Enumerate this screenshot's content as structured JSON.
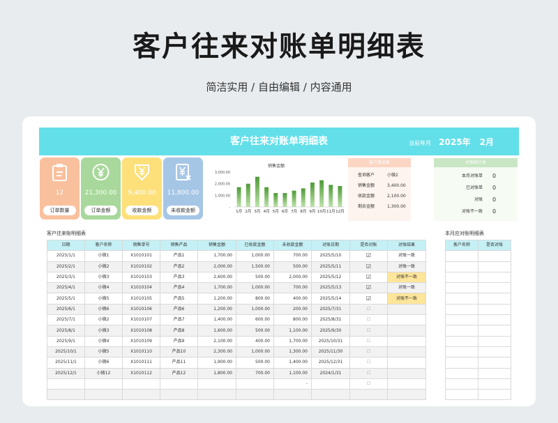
{
  "hero": {
    "title": "客户往来对账单明细表",
    "subtitle": "简洁实用 / 自由编辑 / 内容通用"
  },
  "banner": {
    "title": "客户往来对账单明细表",
    "date_label": "当前年月",
    "year": "2025年",
    "month": "2月"
  },
  "colors": {
    "banner": "#63dfe9",
    "kpi_orders": "#f9c09d",
    "kpi_amount": "#a8d89b",
    "kpi_received": "#fde07a",
    "kpi_unreceived": "#a6c6e6",
    "bar": "#6bb04e",
    "warn": "#fde59a"
  },
  "kpis": [
    {
      "icon": "clipboard-icon",
      "value": "12",
      "label": "订单数量",
      "color": "#f9c09d"
    },
    {
      "icon": "yen-coin-icon",
      "value": "21,300.00",
      "label": "订单金额",
      "color": "#a8d89b"
    },
    {
      "icon": "yen-down-icon",
      "value": "9,400.00",
      "label": "收款金额",
      "color": "#fde07a"
    },
    {
      "icon": "yen-document-icon",
      "value": "11,800.00",
      "label": "未收款金额",
      "color": "#a6c6e6"
    }
  ],
  "chart_data": {
    "type": "bar",
    "title": "销售金额",
    "categories": [
      "1月",
      "2月",
      "3月",
      "4月",
      "5月",
      "6月",
      "7月",
      "8月",
      "9月",
      "10月",
      "11月",
      "12月"
    ],
    "values": [
      1700,
      2000,
      2600,
      1700,
      1200,
      1200,
      1400,
      1600,
      2100,
      2300,
      1900,
      1800
    ],
    "ylim": [
      0,
      3000
    ],
    "yticks": [
      "3,000.00",
      "2,000.00",
      "1,000.00",
      "-"
    ],
    "ytick_values": [
      3000,
      2000,
      1000,
      0
    ],
    "grid": false,
    "legend": "none"
  },
  "query": {
    "header": "客户查询表",
    "rows": [
      {
        "k": "查询客户",
        "v": "小微2"
      },
      {
        "k": "销售金额",
        "v": "3,400.00"
      },
      {
        "k": "收款金额",
        "v": "2,100.00"
      },
      {
        "k": "剩余金额",
        "v": "1,300.00"
      }
    ]
  },
  "stats": {
    "header": "对账统计表",
    "rows": [
      {
        "k": "本月对账单",
        "v": "0"
      },
      {
        "k": "已对账单",
        "v": "0"
      },
      {
        "k": "对账",
        "v": "0"
      },
      {
        "k": "对账不一致",
        "v": "0"
      }
    ]
  },
  "detail": {
    "title": "客户往来账明细表",
    "headers": [
      "日期",
      "客户名称",
      "销售单号",
      "销售产品",
      "销售金额",
      "已收款金额",
      "未收款金额",
      "对账日期",
      "是否对账",
      "对账结果"
    ],
    "rows": [
      [
        "2025/1/1",
        "小微1",
        "X1010101",
        "产品1",
        "1,700.00",
        "1,000.00",
        "700.00",
        "2025/5/10",
        "☑",
        "对账一致"
      ],
      [
        "2025/2/1",
        "小微2",
        "X1010102",
        "产品2",
        "2,000.00",
        "1,500.00",
        "500.00",
        "2025/5/11",
        "☑",
        "对账一致"
      ],
      [
        "2025/3/1",
        "小微3",
        "X1010103",
        "产品3",
        "2,600.00",
        "500.00",
        "2,000.00",
        "2025/5/12",
        "☑",
        "对账不一致"
      ],
      [
        "2025/4/1",
        "小微4",
        "X1010104",
        "产品4",
        "1,700.00",
        "1,000.00",
        "700.00",
        "2025/5/13",
        "☑",
        "对账一致"
      ],
      [
        "2025/5/1",
        "小微5",
        "X1010105",
        "产品5",
        "1,200.00",
        "800.00",
        "400.00",
        "2025/5/14",
        "☑",
        "对账不一致"
      ],
      [
        "2025/6/1",
        "小微6",
        "X1010106",
        "产品6",
        "1,200.00",
        "1,000.00",
        "200.00",
        "2025/7/31",
        "☐",
        ""
      ],
      [
        "2025/7/1",
        "小微2",
        "X1010107",
        "产品7",
        "1,400.00",
        "600.00",
        "800.00",
        "2025/8/31",
        "☐",
        ""
      ],
      [
        "2025/8/1",
        "小微3",
        "X1010108",
        "产品8",
        "1,600.00",
        "500.00",
        "1,100.00",
        "2025/9/30",
        "☐",
        ""
      ],
      [
        "2025/9/1",
        "小微4",
        "X1010109",
        "产品9",
        "2,100.00",
        "400.00",
        "1,700.00",
        "2025/10/31",
        "☐",
        ""
      ],
      [
        "2025/10/1",
        "小微5",
        "X1010110",
        "产品10",
        "2,300.00",
        "1,000.00",
        "1,300.00",
        "2025/11/30",
        "☐",
        ""
      ],
      [
        "2025/11/1",
        "小微6",
        "X1010111",
        "产品11",
        "1,900.00",
        "500.00",
        "1,400.00",
        "2025/12/31",
        "☐",
        ""
      ],
      [
        "2025/12/1",
        "小微12",
        "X1010112",
        "产品12",
        "1,800.00",
        "700.00",
        "1,100.00",
        "2024/1/31",
        "☐",
        ""
      ],
      [
        "",
        "",
        "",
        "",
        "",
        "",
        "-",
        "",
        "☐",
        ""
      ],
      [
        "",
        "",
        "",
        "",
        "",
        "",
        "",
        "",
        "",
        ""
      ]
    ]
  },
  "monthly": {
    "title": "本月应对账明细表",
    "headers": [
      "客户名称",
      "是否对账"
    ]
  }
}
